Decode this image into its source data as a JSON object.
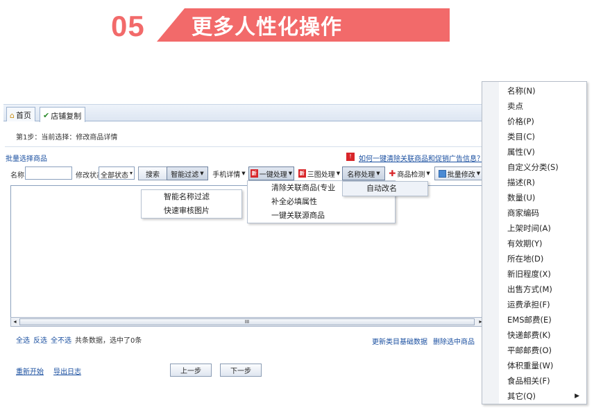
{
  "banner": {
    "number": "05",
    "title": "更多人性化操作",
    "accent": "#f26a6a"
  },
  "tabs": [
    {
      "label": "首页"
    },
    {
      "label": "店铺复制"
    }
  ],
  "step_text": "第1步：当前选择：修改商品详情",
  "select_hint": "批量选择商品",
  "help_link": "如何一键清除关联商品和促销广告信息？",
  "toolbar": {
    "name_label": "名称",
    "status_label": "修改状态",
    "status_value": "全部状态",
    "search": "搜索",
    "smart_filter": "智能过滤",
    "mobile_detail": "手机详情",
    "one_key": "一键处理",
    "three_img": "三图处理",
    "name_process": "名称处理",
    "product_check": "商品检测",
    "batch_modify": "批量修改"
  },
  "scroll_grip": "III",
  "bottom_links": [
    "全选",
    "反选",
    "全不选"
  ],
  "bottom_status": "共条数据，选中了0条",
  "right_links": [
    "更新类目基础数据",
    "删除选中商品"
  ],
  "foot_links": [
    "重新开始",
    "导出日志"
  ],
  "buttons": {
    "prev": "上一步",
    "next": "下一步"
  },
  "smart_menu": [
    "智能名称过滤",
    "快速审核图片"
  ],
  "onekey_menu": [
    "清除关联商品(专业",
    "补全必填属性",
    "一键关联源商品"
  ],
  "name_menu": [
    "自动改名"
  ],
  "field_menu": [
    "名称(N)",
    "卖点",
    "价格(P)",
    "类目(C)",
    "属性(V)",
    "自定义分类(S)",
    "描述(R)",
    "数量(U)",
    "商家编码",
    "上架时间(A)",
    "有效期(Y)",
    "所在地(D)",
    "新旧程度(X)",
    "出售方式(M)",
    "运费承担(F)",
    "EMS邮费(E)",
    "快递邮费(K)",
    "平邮邮费(O)",
    "体积重量(W)",
    "食品相关(F)",
    "其它(Q)"
  ],
  "badges": {
    "new": "新"
  }
}
